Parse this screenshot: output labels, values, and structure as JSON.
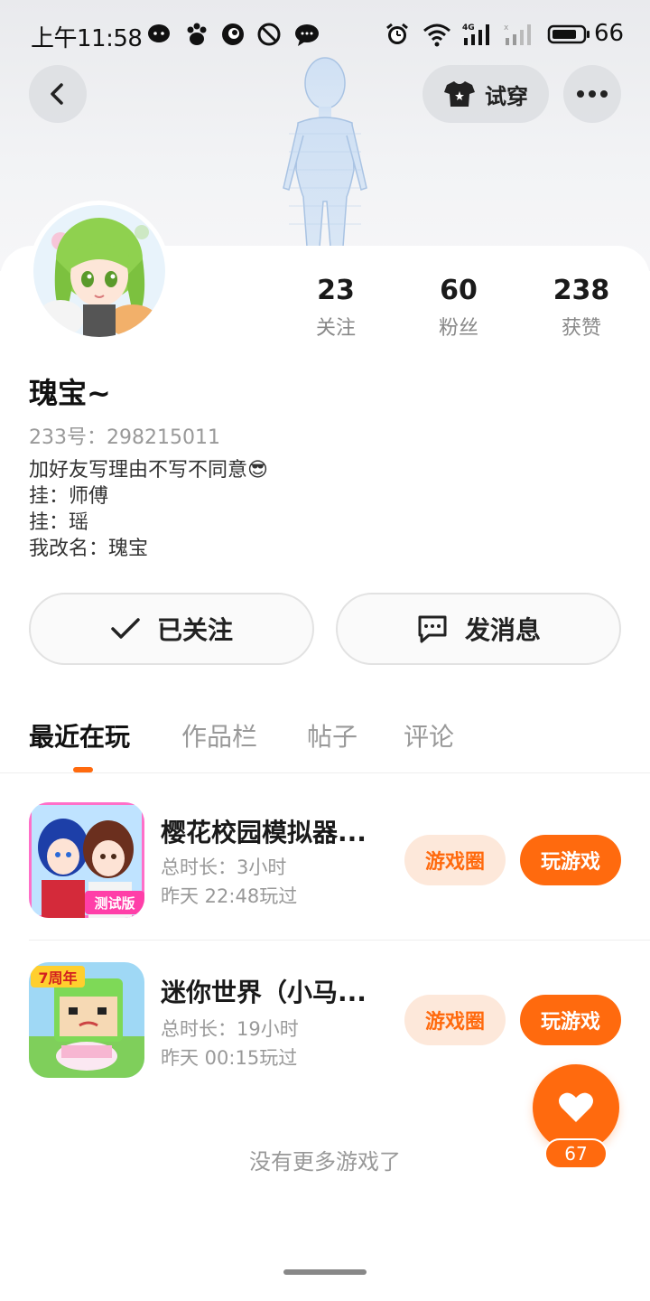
{
  "status_bar": {
    "time": "上午11:58",
    "battery": "66",
    "icons": [
      "chat-bubble-face-icon",
      "baidu-paw-icon",
      "swirl-app-icon",
      "do-not-disturb-icon",
      "message-icon",
      "alarm-icon",
      "wifi-icon",
      "signal-4g-icon",
      "signal-2-icon",
      "battery-icon"
    ]
  },
  "header": {
    "back_icon": "chevron-left-icon",
    "try_on_label": "试穿",
    "try_on_icon": "shirt-icon",
    "more_icon": "more-dots-icon"
  },
  "profile": {
    "stats": [
      {
        "value": "23",
        "label": "关注"
      },
      {
        "value": "60",
        "label": "粉丝"
      },
      {
        "value": "238",
        "label": "获赞"
      }
    ],
    "nickname": "瑰宝~",
    "uid": "233号：298215011",
    "bio_lines": [
      "加好友写理由不写不同意😎",
      "挂：师傅",
      "挂：瑶",
      "我改名：瑰宝"
    ]
  },
  "actions": {
    "follow_label": "已关注",
    "message_label": "发消息"
  },
  "tabs": [
    {
      "label": "最近在玩",
      "active": true
    },
    {
      "label": "作品栏",
      "active": false
    },
    {
      "label": "帖子",
      "active": false
    },
    {
      "label": "评论",
      "active": false
    }
  ],
  "games": [
    {
      "title": "樱花校园模拟器...",
      "duration": "总时长：3小时",
      "last_played": "昨天  22:48玩过",
      "circle_label": "游戏圈",
      "play_label": "玩游戏",
      "icon_badge": "测试版"
    },
    {
      "title": "迷你世界（小马...",
      "duration": "总时长：19小时",
      "last_played": "昨天  00:15玩过",
      "circle_label": "游戏圈",
      "play_label": "玩游戏",
      "icon_badge": "7周年"
    }
  ],
  "footer_text": "没有更多游戏了",
  "like_fab": {
    "count": "67",
    "icon": "heart-icon"
  },
  "colors": {
    "accent": "#ff6a0e",
    "accent_light": "#fde8da",
    "text_muted": "#999999"
  }
}
